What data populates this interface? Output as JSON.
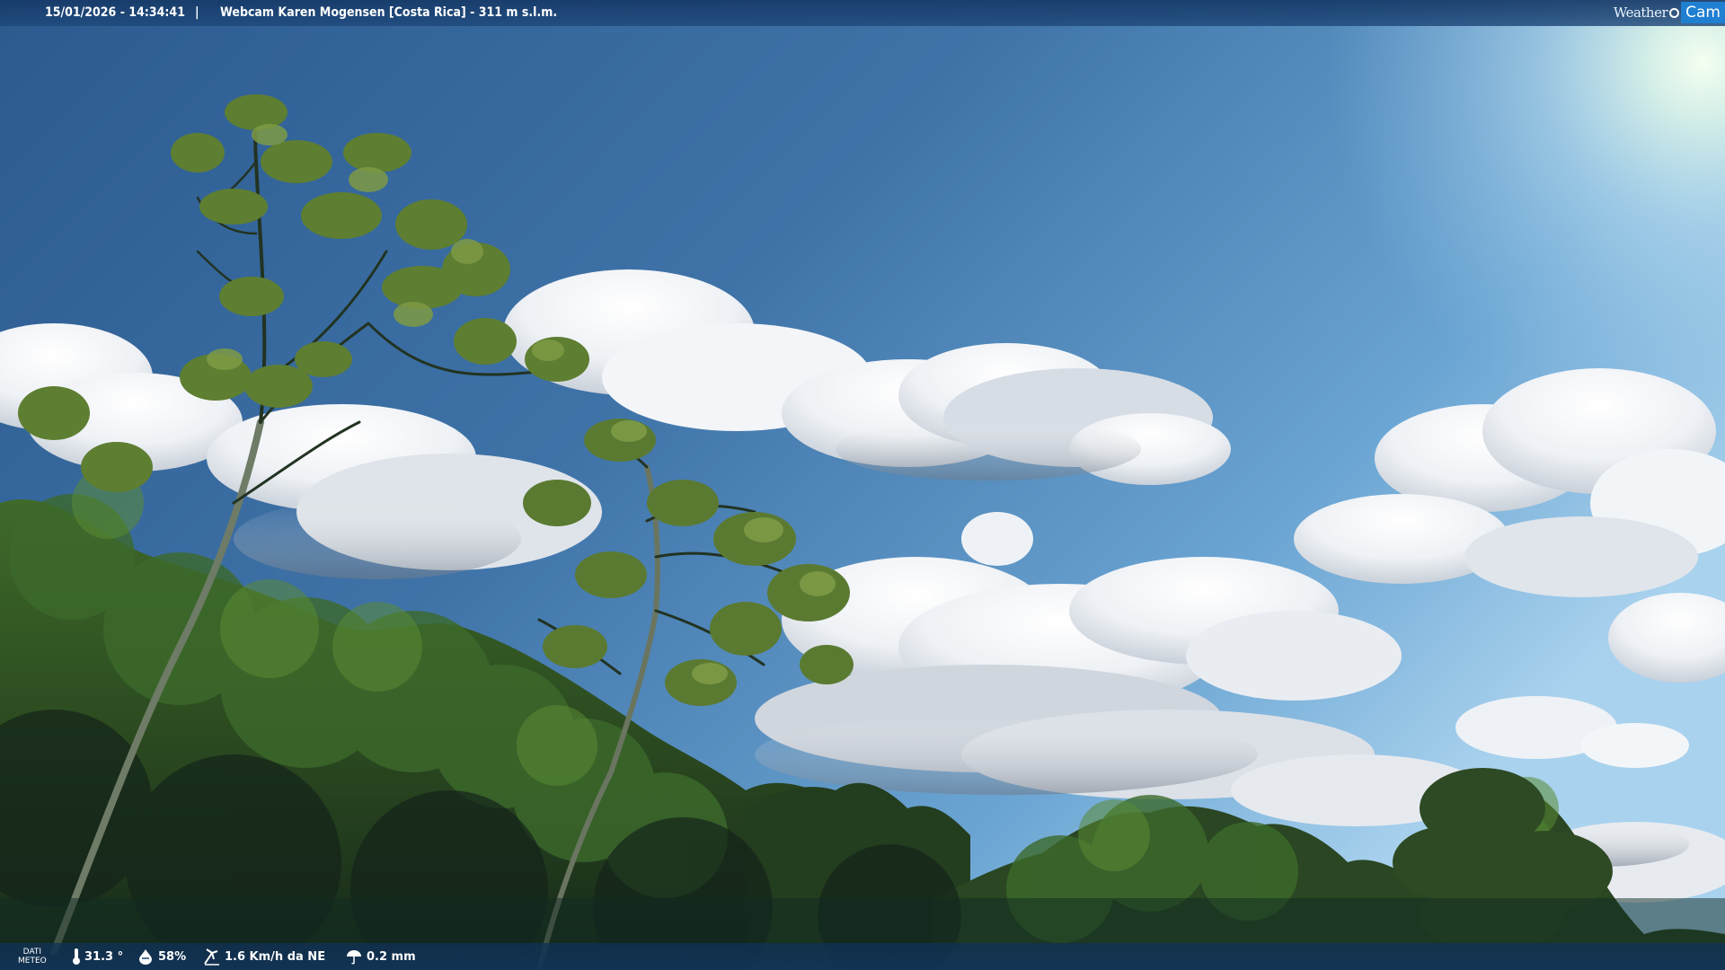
{
  "overlay": {
    "timestamp": "15/01/2026 - 14:34:41",
    "separator": "|",
    "title": "Webcam Karen Mogensen [Costa Rica]  - 311 m s.l.m.",
    "logo_text_1": "Weather",
    "logo_text_2": "Cam"
  },
  "weather": {
    "label_line1": "DATI",
    "label_line2": "METEO",
    "temperature": "31.3 °",
    "humidity": "58%",
    "wind": "1.6 Km/h da NE",
    "rain": "0.2 mm"
  },
  "icons": {
    "temperature": "thermometer-icon",
    "humidity": "humidity-drop-icon",
    "wind": "wind-icon",
    "rain": "rain-gauge-icon"
  },
  "colors": {
    "sky_top": "#2f5f95",
    "sky_bright": "#b9dcf2",
    "foliage_dark": "#18301a",
    "foliage_light": "#4f7d2e",
    "bar": "#1a3f6c",
    "logo_accent": "#1f7fd1"
  }
}
